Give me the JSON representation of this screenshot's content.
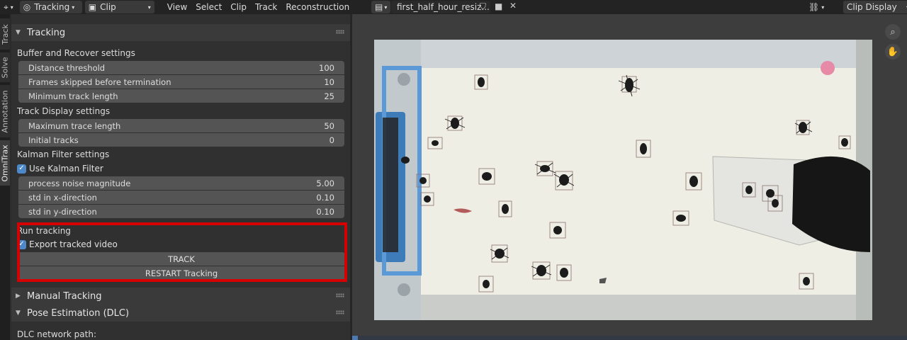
{
  "header": {
    "editor_icon": "⌖",
    "workspace": "Tracking",
    "mode": "Clip",
    "menus": [
      "View",
      "Select",
      "Clip",
      "Track",
      "Reconstruction"
    ],
    "file_name": "first_half_hour_resiz...",
    "display_mode": "Clip Display"
  },
  "vtabs": [
    "Track",
    "Solve",
    "Annotation",
    "OmniTrax"
  ],
  "panel": {
    "title": "Tracking",
    "buffer_section": "Buffer and Recover settings",
    "buffer_fields": [
      {
        "label": "Distance threshold",
        "value": "100"
      },
      {
        "label": "Frames skipped before termination",
        "value": "10"
      },
      {
        "label": "Minimum track length",
        "value": "25"
      }
    ],
    "display_section": "Track Display settings",
    "display_fields": [
      {
        "label": "Maximum trace length",
        "value": "50"
      },
      {
        "label": "Initial tracks",
        "value": "0"
      }
    ],
    "kalman_section": "Kalman Filter settings",
    "use_kalman_label": "Use Kalman Filter",
    "kalman_fields": [
      {
        "label": "process noise magnitude",
        "value": "5.00"
      },
      {
        "label": "std in x-direction",
        "value": "0.10"
      },
      {
        "label": "std in y-direction",
        "value": "0.10"
      }
    ],
    "run_section": "Run tracking",
    "export_label": "Export tracked video",
    "track_button": "TRACK",
    "restart_button": "RESTART Tracking"
  },
  "manual_panel": "Manual Tracking",
  "pose_panel": "Pose Estimation (DLC)",
  "dlc_path_label": "DLC network path:",
  "icons": {
    "zoom": "zoom-icon",
    "pan": "hand-icon",
    "clip": "film-icon",
    "shield": "shield-icon",
    "folder": "folder-icon",
    "close": "close-icon",
    "link": "link-icon"
  }
}
